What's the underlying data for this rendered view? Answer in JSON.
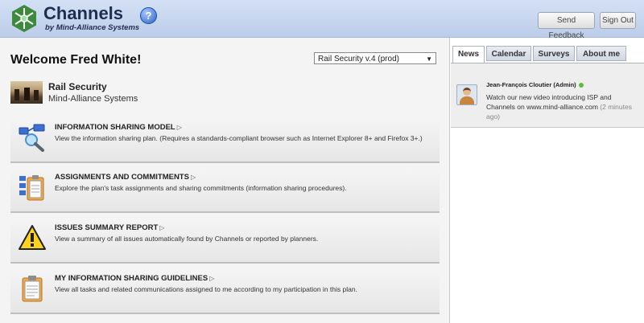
{
  "header": {
    "title": "Channels",
    "subtitle": "by Mind-Alliance Systems",
    "help_label": "?",
    "send_feedback": "Send Feedback",
    "sign_out": "Sign Out"
  },
  "welcome": "Welcome Fred White!",
  "plan_selector": {
    "selected": "Rail Security v.4 (prod)"
  },
  "plan": {
    "name": "Rail Security",
    "organization": "Mind-Alliance Systems"
  },
  "sections": [
    {
      "title": "INFORMATION SHARING MODEL",
      "description": "View the information sharing plan. (Requires a standards-compliant browser such as Internet Explorer 8+ and Firefox 3+.)"
    },
    {
      "title": "ASSIGNMENTS AND COMMITMENTS",
      "description": "Explore the plan's task assignments and sharing commitments (information sharing procedures)."
    },
    {
      "title": "ISSUES SUMMARY REPORT",
      "description": "View a summary of all issues automatically found by Channels or reported by planners."
    },
    {
      "title": "MY INFORMATION SHARING GUIDELINES",
      "description": "View all tasks and related communications assigned to me according to my participation in this plan."
    }
  ],
  "tabs": [
    {
      "label": "News"
    },
    {
      "label": "Calendar"
    },
    {
      "label": "Surveys"
    },
    {
      "label": "About me"
    }
  ],
  "news": {
    "author": "Jean-François Cloutier (Admin)",
    "message": "Watch our new video introducing ISP and Channels on www.mind-alliance.com",
    "time": "(2 minutes ago)"
  },
  "colors": {
    "header_bg": "#c8d6ef",
    "online": "#5cbf3a",
    "accent_blue": "#2e63c6"
  }
}
